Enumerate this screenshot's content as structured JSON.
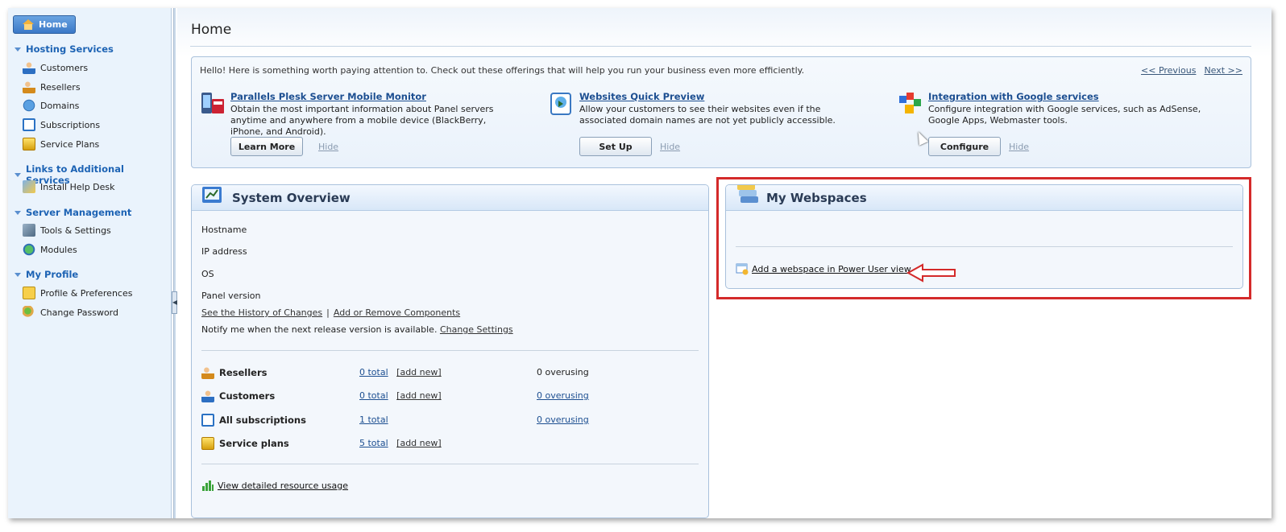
{
  "sidebar": {
    "home_label": "Home",
    "sections": [
      {
        "title": "Hosting Services",
        "items": [
          "Customers",
          "Resellers",
          "Domains",
          "Subscriptions",
          "Service Plans"
        ]
      },
      {
        "title": "Links to Additional Services",
        "items": [
          "Install Help Desk"
        ]
      },
      {
        "title": "Server Management",
        "items": [
          "Tools & Settings",
          "Modules"
        ]
      },
      {
        "title": "My Profile",
        "items": [
          "Profile & Preferences",
          "Change Password"
        ]
      }
    ]
  },
  "page": {
    "title": "Home"
  },
  "promo": {
    "intro": "Hello! Here is something worth paying attention to. Check out these offerings that will help you run your business even more efficiently.",
    "prev": "<< Previous",
    "next": "Next >>",
    "offers": [
      {
        "title": "Parallels Plesk Server Mobile Monitor",
        "desc": "Obtain the most important information about Panel servers anytime and anywhere from a mobile device (BlackBerry, iPhone, and Android).",
        "button": "Learn More",
        "hide": "Hide"
      },
      {
        "title": "Websites Quick Preview",
        "desc": "Allow your customers to see their websites even if the associated domain names are not yet publicly accessible.",
        "button": "Set Up",
        "hide": "Hide"
      },
      {
        "title": "Integration with Google services",
        "desc": "Configure integration with Google services, such as AdSense, Google Apps, Webmaster tools.",
        "button": "Configure",
        "hide": "Hide"
      }
    ]
  },
  "system_overview": {
    "title": "System Overview",
    "labels": {
      "hostname": "Hostname",
      "ip": "IP address",
      "os": "OS",
      "panel": "Panel version"
    },
    "history_link": "See the History of Changes",
    "components_link": "Add or Remove Components",
    "separator": "|",
    "notify_text": "Notify me when the next release version is available.",
    "change_settings": "Change Settings",
    "stats": [
      {
        "label": "Resellers",
        "total": "0 total",
        "add": "[add new]",
        "over": "0 overusing"
      },
      {
        "label": "Customers",
        "total": "0 total",
        "add": "[add new]",
        "over": "0 overusing"
      },
      {
        "label": "All subscriptions",
        "total": "1 total",
        "add": "",
        "over": "0 overusing"
      },
      {
        "label": "Service plans",
        "total": "5 total",
        "add": "[add new]",
        "over": ""
      }
    ],
    "resource_link": "View detailed resource usage"
  },
  "webspaces": {
    "title": "My Webspaces",
    "add_link": "Add a webspace in Power User view"
  },
  "colors": {
    "accent": "#1d63b4",
    "highlight": "#d42a2a"
  }
}
